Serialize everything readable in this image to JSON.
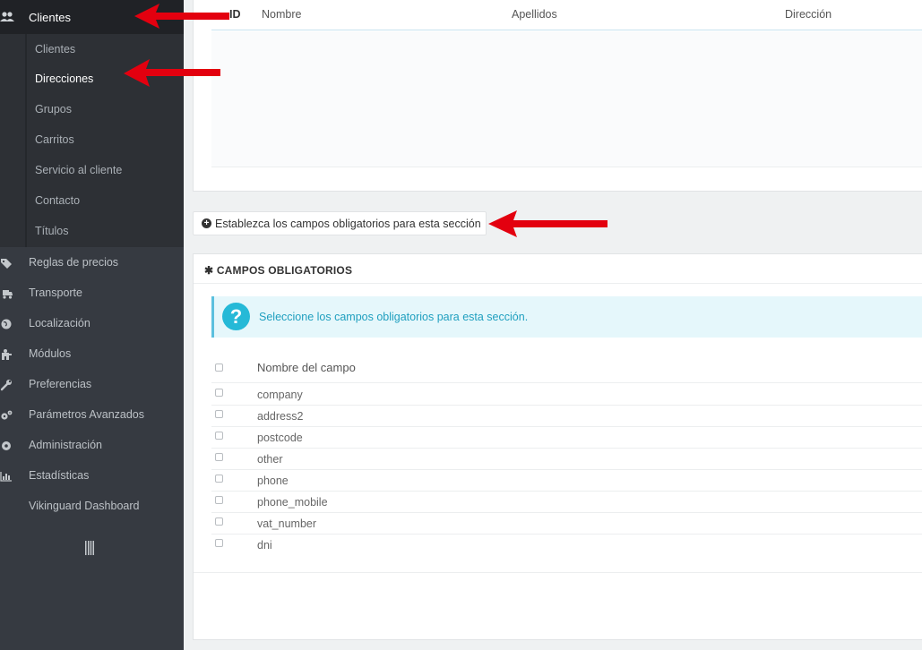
{
  "sidebar": {
    "top_item": {
      "label": "Clientes",
      "icon": "users-icon"
    },
    "sub_items": [
      {
        "label": "Clientes",
        "active": false
      },
      {
        "label": "Direcciones",
        "active": true
      },
      {
        "label": "Grupos",
        "active": false
      },
      {
        "label": "Carritos",
        "active": false
      },
      {
        "label": "Servicio al cliente",
        "active": false
      },
      {
        "label": "Contacto",
        "active": false
      },
      {
        "label": "Títulos",
        "active": false
      }
    ],
    "main_items": [
      {
        "label": "Reglas de precios",
        "icon": "tag-icon"
      },
      {
        "label": "Transporte",
        "icon": "truck-icon"
      },
      {
        "label": "Localización",
        "icon": "globe-icon"
      },
      {
        "label": "Módulos",
        "icon": "puzzle-icon"
      },
      {
        "label": "Preferencias",
        "icon": "wrench-icon"
      },
      {
        "label": "Parámetros Avanzados",
        "icon": "cogs-icon"
      },
      {
        "label": "Administración",
        "icon": "gear-icon"
      },
      {
        "label": "Estadísticas",
        "icon": "bar-chart-icon"
      },
      {
        "label": "Vikinguard Dashboard",
        "icon": ""
      }
    ]
  },
  "address_table": {
    "columns": [
      "ID",
      "Nombre",
      "Apellidos",
      "Dirección"
    ]
  },
  "set_required_button": "Establezca los campos obligatorios para esta sección",
  "required_panel": {
    "title": "CAMPOS OBLIGATORIOS",
    "info": "Seleccione los campos obligatorios para esta sección.",
    "column_header": "Nombre del campo",
    "fields": [
      "company",
      "address2",
      "postcode",
      "other",
      "phone",
      "phone_mobile",
      "vat_number",
      "dni"
    ]
  },
  "colors": {
    "sidebar_bg": "#363a41",
    "sidebar_active_bg": "#202226",
    "info_accent": "#25b9d7",
    "arrow_red": "#e3000f"
  }
}
